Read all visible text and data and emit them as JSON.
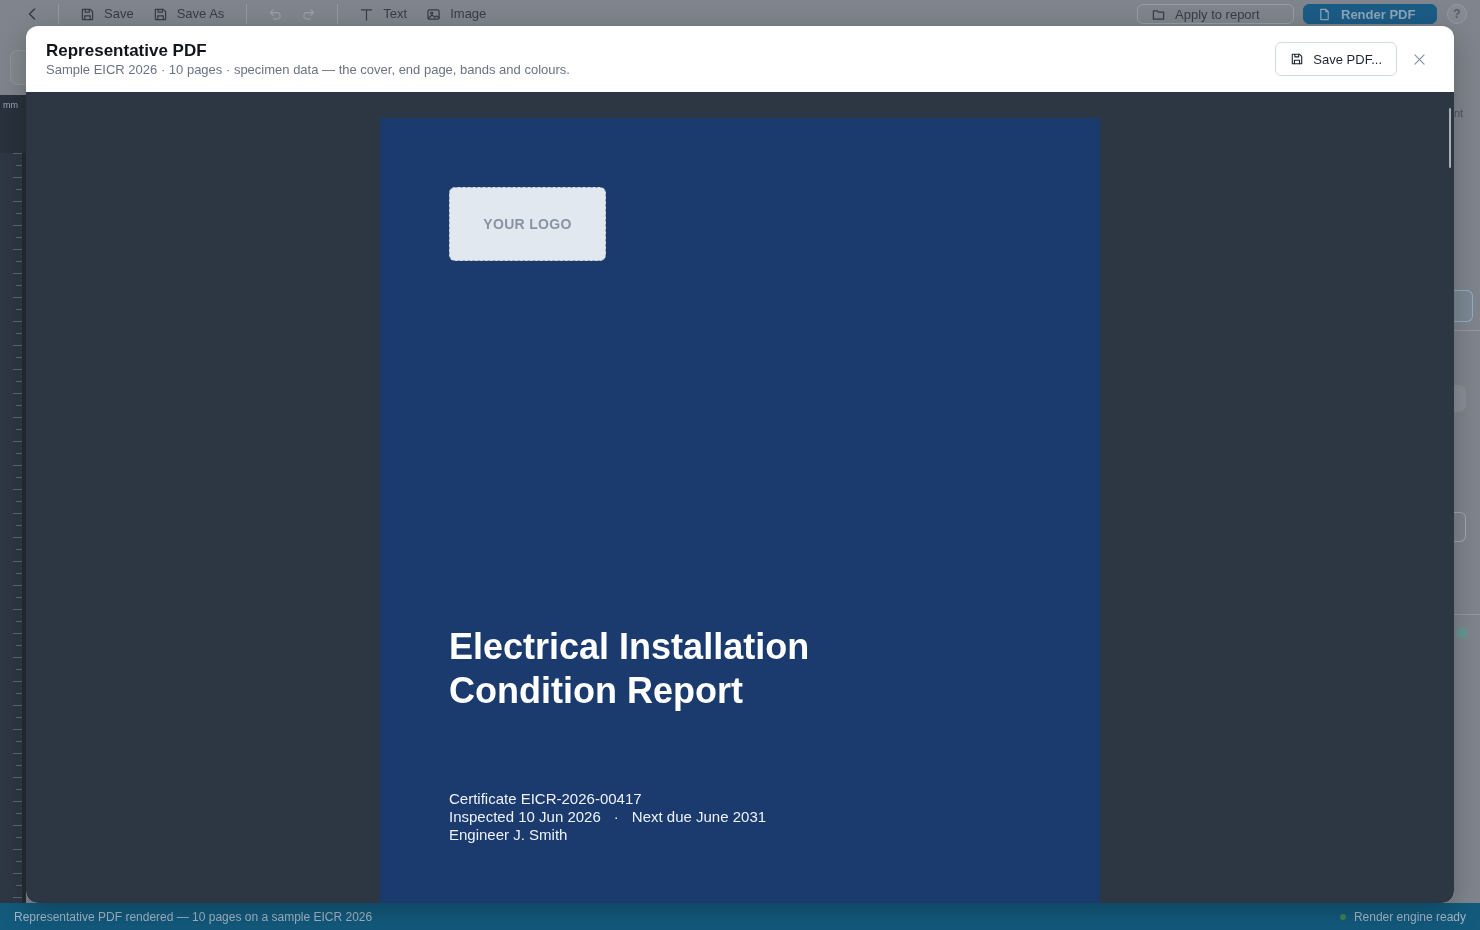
{
  "app_toolbar": {
    "tool_groups": [
      [
        {
          "kind": "back",
          "disabled": false
        }
      ],
      [
        {
          "kind": "save",
          "label": "Save",
          "disabled": false
        },
        {
          "kind": "save_as",
          "label": "Save As",
          "disabled": false
        }
      ],
      [
        {
          "kind": "undo",
          "disabled": true
        },
        {
          "kind": "redo",
          "disabled": true
        }
      ],
      [
        {
          "kind": "text",
          "label": "Text",
          "disabled": false
        },
        {
          "kind": "image",
          "label": "Image",
          "disabled": false
        }
      ]
    ],
    "apply_button": "Apply to report",
    "render_button": "Render PDF",
    "help_button": "?"
  },
  "ruler": {
    "unit": "mm"
  },
  "side_panel": {
    "label_fragment": "nt"
  },
  "dialog": {
    "title": "Representative PDF",
    "subtitle": "Sample EICR 2026 · 10 pages · specimen data — the cover, end page, bands and colours.",
    "save_button": "Save PDF...",
    "page": {
      "logo_placeholder": "YOUR LOGO",
      "title": "Electrical Installation Condition Report",
      "details": [
        [
          "Certificate EICR-2026-00417"
        ],
        [
          "Inspected 10 Jun 2026",
          "·",
          "Next due June 2031"
        ],
        [
          "Engineer J. Smith"
        ]
      ]
    }
  },
  "status_bar": {
    "message": "Representative PDF rendered — 10 pages on a sample EICR 2026",
    "engine_status": "Render engine ready"
  }
}
